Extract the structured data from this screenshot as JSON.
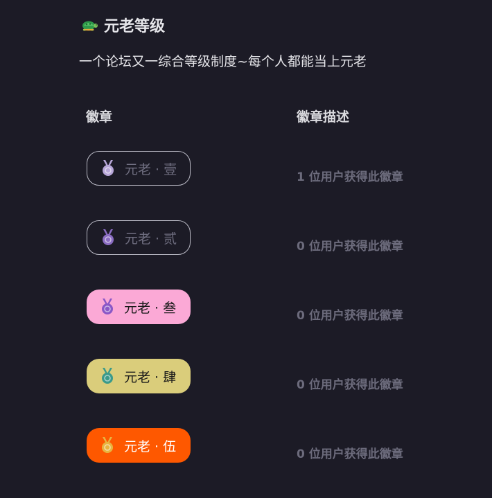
{
  "header": {
    "title": "元老等级",
    "title_icon": "turtle-icon",
    "subtitle": "一个论坛又一综合等级制度~每个人都能当上元老"
  },
  "table": {
    "col_badge": "徽章",
    "col_desc": "徽章描述"
  },
  "badges": [
    {
      "label": "元老 · 壹",
      "description": "1 位用户获得此徽章",
      "style": "outlined",
      "bg": "transparent",
      "text_color": "#6f6e80",
      "medal_color": "#b7a6d8",
      "icon": "medal-icon"
    },
    {
      "label": "元老 · 贰",
      "description": "0 位用户获得此徽章",
      "style": "outlined",
      "bg": "transparent",
      "text_color": "#6f6e80",
      "medal_color": "#8a6cc2",
      "icon": "medal-icon"
    },
    {
      "label": "元老 · 叁",
      "description": "0 位用户获得此徽章",
      "style": "filled",
      "bg": "#fba9d6",
      "text_color": "#1a1a1a",
      "medal_color": "#8a57c6",
      "icon": "medal-icon"
    },
    {
      "label": "元老 · 肆",
      "description": "0 位用户获得此徽章",
      "style": "filled",
      "bg": "#dacd7b",
      "text_color": "#1a1a1a",
      "medal_color": "#3a9a8a",
      "icon": "medal-icon"
    },
    {
      "label": "元老 · 伍",
      "description": "0 位用户获得此徽章",
      "style": "filled",
      "bg": "#fe5800",
      "text_color": "#ffffff",
      "medal_color": "#e8b440",
      "icon": "medal-icon"
    }
  ]
}
